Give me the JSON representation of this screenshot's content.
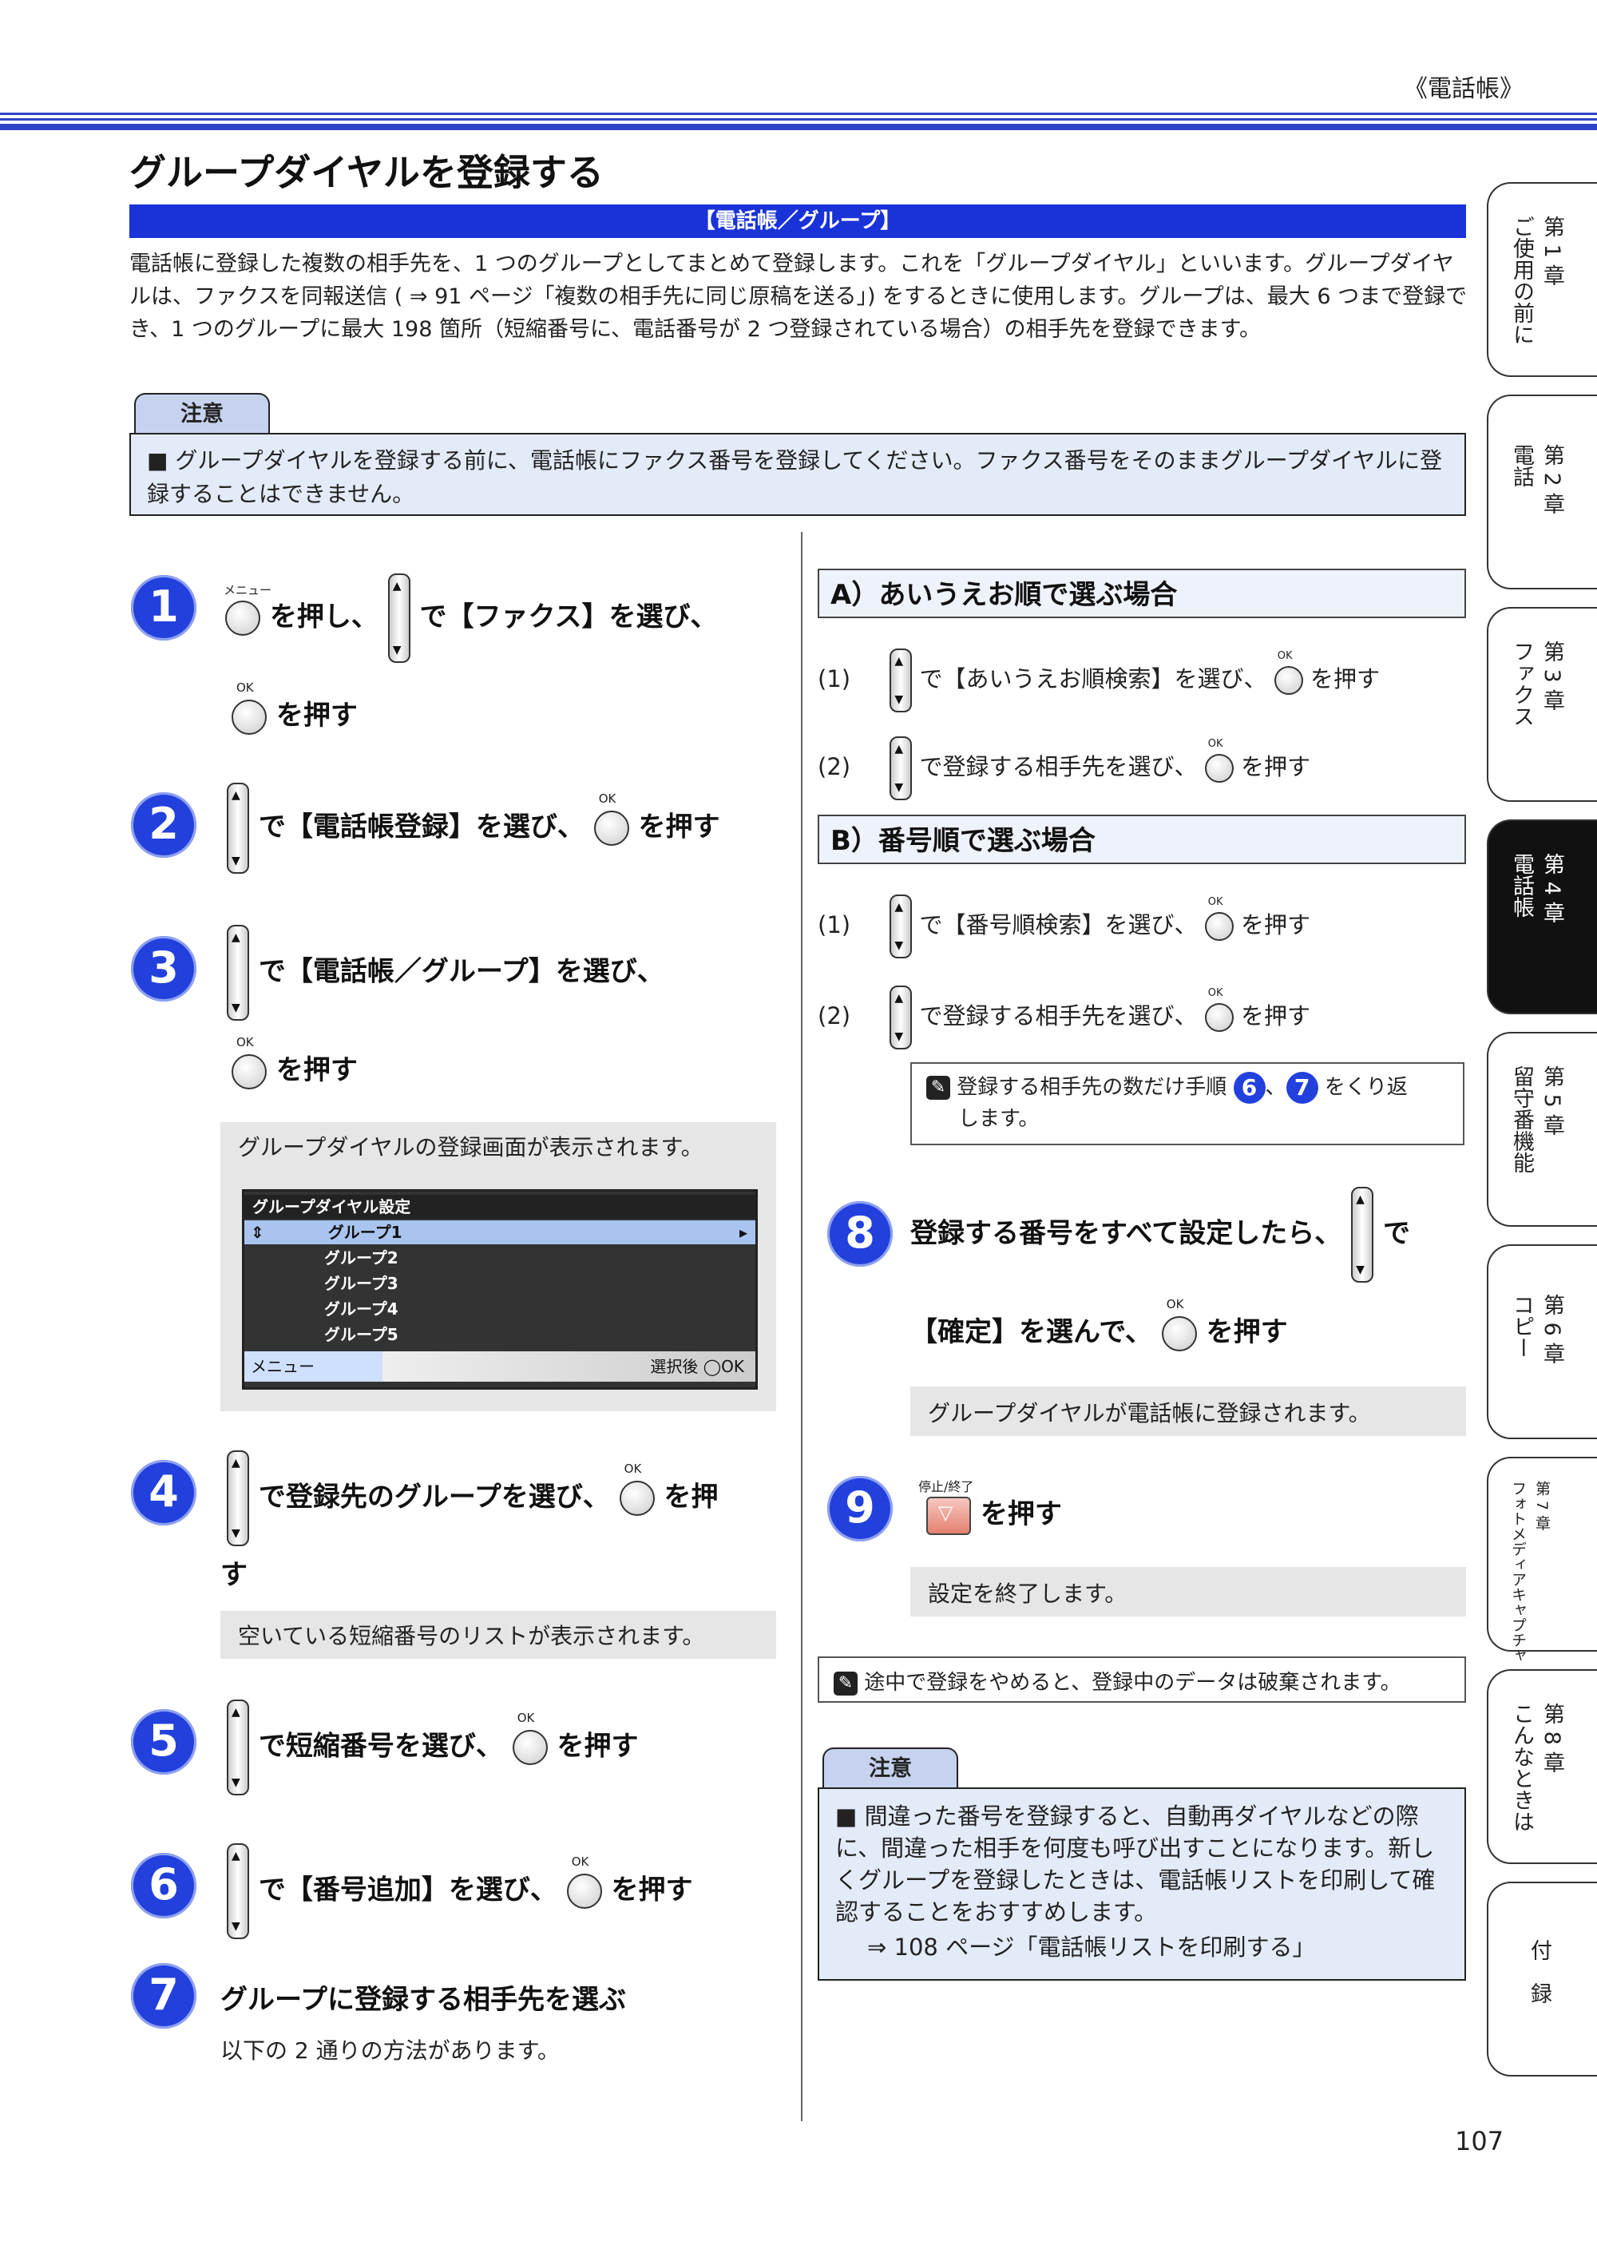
{
  "header": {
    "section": "《電話帳》"
  },
  "title": "グループダイヤルを登録する",
  "menu_path": "【電話帳／グループ】",
  "intro": "電話帳に登録した複数の相手先を、1 つのグループとしてまとめて登録します。これを「グループダイヤル」といいます。グループダイヤルは、ファクスを同報送信 ( ⇒ 91 ページ「複数の相手先に同じ原稿を送る」) をするときに使用します。グループは、最大 6 つまで登録でき、1 つのグループに最大 198 箇所（短縮番号に、電話番号が 2 つ登録されている場合）の相手先を登録できます。",
  "caution_top": {
    "tab": "注意",
    "text": "■  グループダイヤルを登録する前に、電話帳にファクス番号を登録してください。ファクス番号をそのままグループダイヤルに登録することはできません。"
  },
  "buttons": {
    "ok_label": "OK",
    "menu_label": "メニュー",
    "stop_label": "停止/終了"
  },
  "steps": [
    {
      "num": "1",
      "line1a": "を押し、",
      "line1b": "で【ファクス】を選び、",
      "line2": "を押す"
    },
    {
      "num": "2",
      "text_a": "で【電話帳登録】を選び、",
      "text_b": "を押す"
    },
    {
      "num": "3",
      "line1": "で【電話帳／グループ】を選び、",
      "line2": "を押す",
      "note": "グループダイヤルの登録画面が表示されます。"
    },
    {
      "num": "4",
      "text_a": "で登録先のグループを選び、",
      "text_b": "を押",
      "text_c": "す",
      "note": "空いている短縮番号のリストが表示されます。"
    },
    {
      "num": "5",
      "text_a": "で短縮番号を選び、",
      "text_b": "を押す"
    },
    {
      "num": "6",
      "text_a": "で【番号追加】を選び、",
      "text_b": "を押す"
    },
    {
      "num": "7",
      "text": "グループに登録する相手先を選ぶ",
      "note": "以下の 2 通りの方法があります。"
    },
    {
      "num": "8",
      "line1": "登録する番号をすべて設定したら、",
      "line1b": "で",
      "line2a": "【確定】を選んで、",
      "line2b": "を押す",
      "note": "グループダイヤルが電話帳に登録されます。"
    },
    {
      "num": "9",
      "text": "を押す",
      "note": "設定を終了します。"
    }
  ],
  "lcd": {
    "title": "グループダイヤル設定",
    "rows": [
      "グループ1",
      "グループ2",
      "グループ3",
      "グループ4",
      "グループ5"
    ],
    "footer_left": "メニュー",
    "footer_right": "選択後",
    "footer_ok": "OK"
  },
  "method_a": {
    "heading": "A）あいうえお順で選ぶ場合",
    "items": [
      {
        "n": "(1)",
        "a": "で【あいうえお順検索】を選び、",
        "b": "を押す"
      },
      {
        "n": "(2)",
        "a": "で登録する相手先を選び、",
        "b": "を押す"
      }
    ]
  },
  "method_b": {
    "heading": "B）番号順で選ぶ場合",
    "items": [
      {
        "n": "(1)",
        "a": "で【番号順検索】を選び、",
        "b": "を押す"
      },
      {
        "n": "(2)",
        "a": "で登録する相手先を選び、",
        "b": "を押す"
      }
    ]
  },
  "tip_repeat": {
    "a": "登録する相手先の数だけ手順",
    "n1": "6",
    "sep": "、",
    "n2": "7",
    "b": "をくり返",
    "c": "します。"
  },
  "tip_cancel": "途中で登録をやめると、登録中のデータは破棄されます。",
  "caution_bottom": {
    "tab": "注意",
    "text": "■  間違った番号を登録すると、自動再ダイヤルなどの際に、間違った相手を何度も呼び出すことになります。新しくグループを登録したときは、電話帳リストを印刷して確認することをおすすめします。",
    "ref": "⇒ 108 ページ「電話帳リストを印刷する」"
  },
  "chapters": [
    {
      "label": "第 1 章\nご使用の前に",
      "active": false
    },
    {
      "label": "第 2 章\n電話",
      "active": false
    },
    {
      "label": "第 3 章\nファクス",
      "active": false
    },
    {
      "label": "第 4 章\n電話帳",
      "active": true
    },
    {
      "label": "第 5 章\n留守番機能",
      "active": false
    },
    {
      "label": "第 6 章\nコピー",
      "active": false
    },
    {
      "label": "第 7 章\nフォトメディアキャプチャ",
      "active": false
    },
    {
      "label": "第 8 章\nこんなときは",
      "active": false
    },
    {
      "label": "付　録",
      "active": false
    }
  ],
  "page_number": "107"
}
